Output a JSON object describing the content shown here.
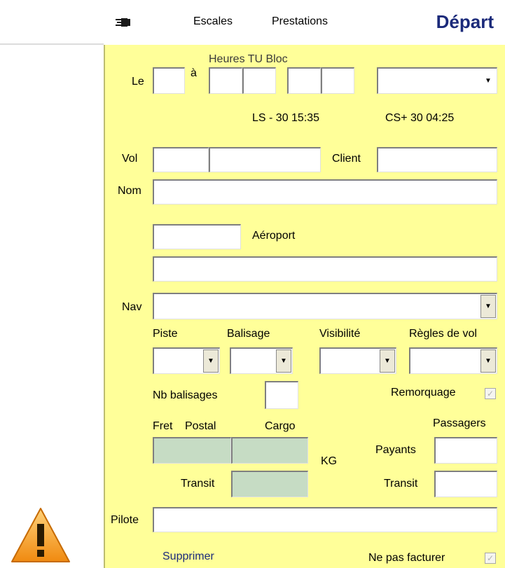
{
  "tabs": {
    "escales": "Escales",
    "prestations": "Prestations",
    "title": "Départ"
  },
  "form": {
    "le": "Le",
    "a": "à",
    "heures_tu_bloc": "Heures TU Bloc",
    "ls": "LS - 30  15:35",
    "cs": "CS+ 30  04:25",
    "vol": "Vol",
    "client": "Client",
    "nom": "Nom",
    "aeroport": "Aéroport",
    "nav": "Nav",
    "piste": "Piste",
    "balisage": "Balisage",
    "visibilite": "Visibilité",
    "regles_de_vol": "Règles de vol",
    "nb_balisages": "Nb balisages",
    "remorquage": "Remorquage",
    "fret": "Fret",
    "postal": "Postal",
    "cargo": "Cargo",
    "kg": "KG",
    "passagers": "Passagers",
    "payants": "Payants",
    "transit_fret": "Transit",
    "transit_pax": "Transit",
    "pilote": "Pilote",
    "supprimer": "Supprimer",
    "ne_pas_facturer": "Ne pas facturer"
  },
  "checkboxes": {
    "remorquage_checked": true,
    "ne_pas_facturer_checked": true
  },
  "icons": {
    "tab_icon": "plug-icon",
    "warning": "warning-icon"
  },
  "colors": {
    "panel": "#ffff99",
    "title": "#1b2a7a",
    "readonly_field": "#c6dcc4",
    "warning": "#f0a020"
  }
}
